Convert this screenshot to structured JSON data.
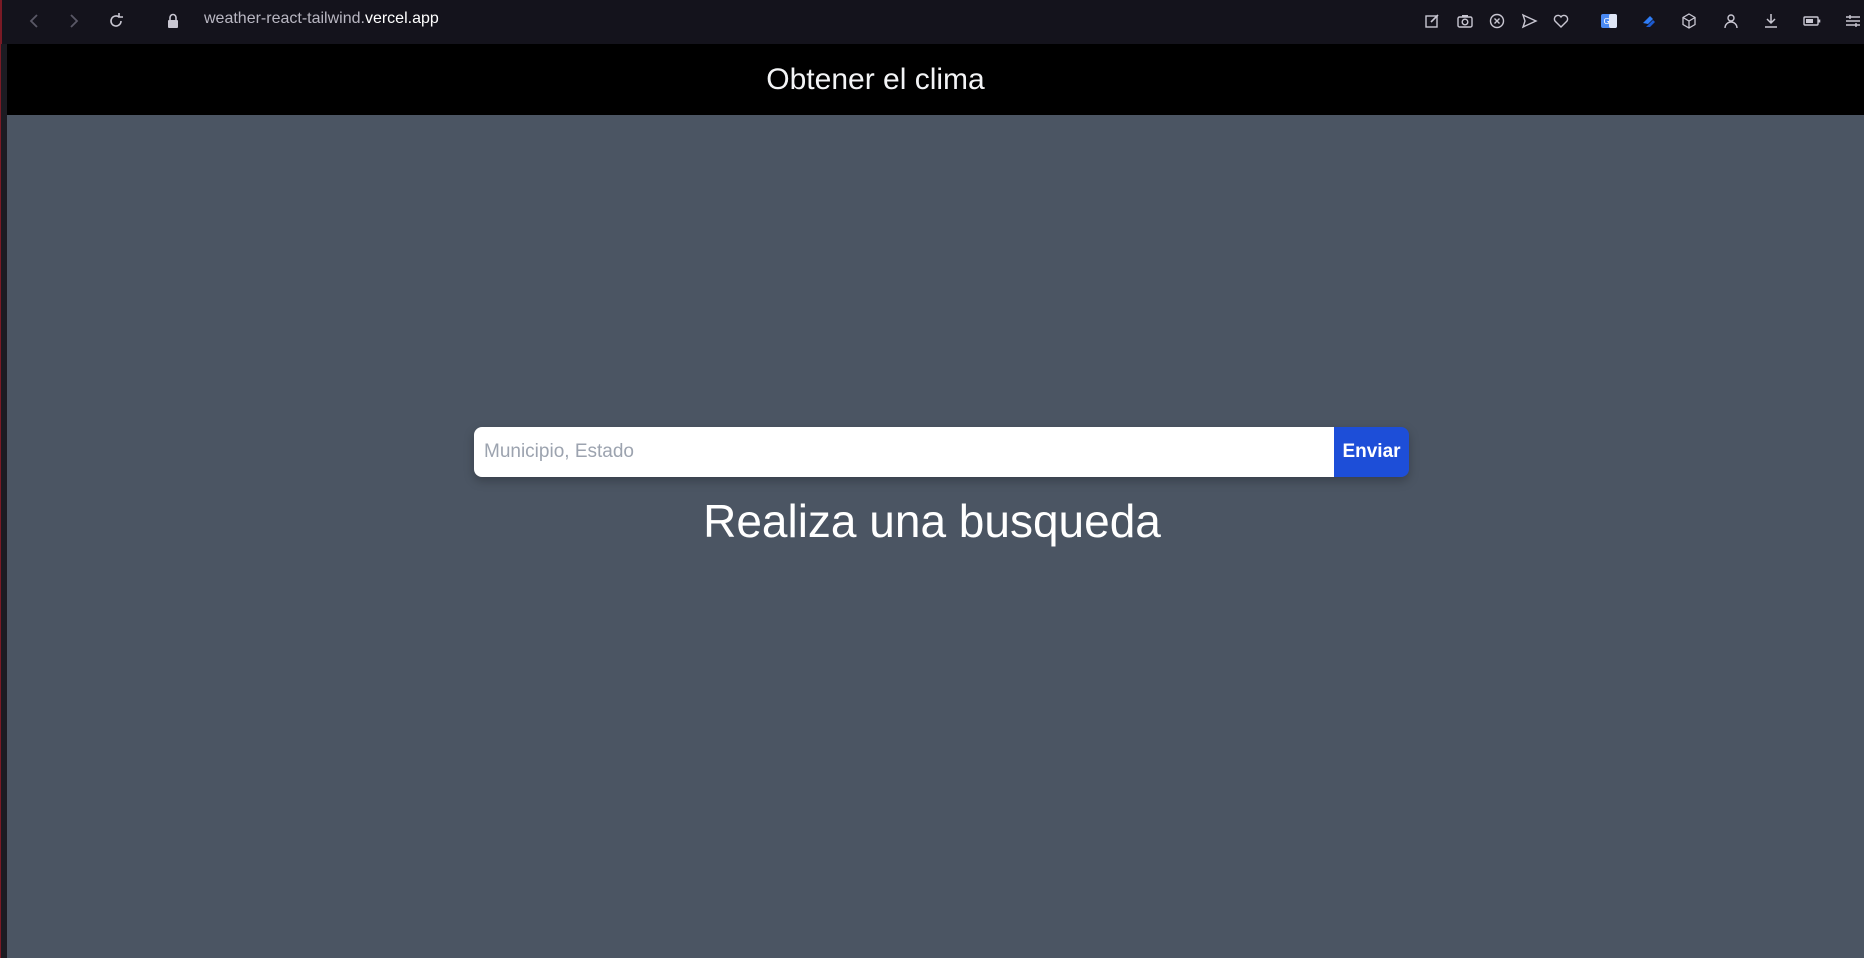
{
  "browser": {
    "url_prefix": "weather-react-tailwind.",
    "url_domain": "vercel.app",
    "icons": [
      "back-icon",
      "forward-icon",
      "reload-icon",
      "lock-icon",
      "edit-icon",
      "camera-icon",
      "close-circle-icon",
      "send-icon",
      "heart-icon",
      "translate-icon",
      "extension-icon",
      "box-icon",
      "profile-icon",
      "download-icon",
      "battery-icon",
      "menu-icon"
    ]
  },
  "header": {
    "title": "Obtener el clima"
  },
  "search": {
    "placeholder": "Municipio, Estado",
    "value": "",
    "button_label": "Enviar"
  },
  "main": {
    "prompt": "Realiza una busqueda"
  },
  "colors": {
    "page_bg": "#4b5563",
    "header_bg": "#000000",
    "button_bg": "#1d4ed8",
    "browser_bar_bg": "#14131c"
  }
}
